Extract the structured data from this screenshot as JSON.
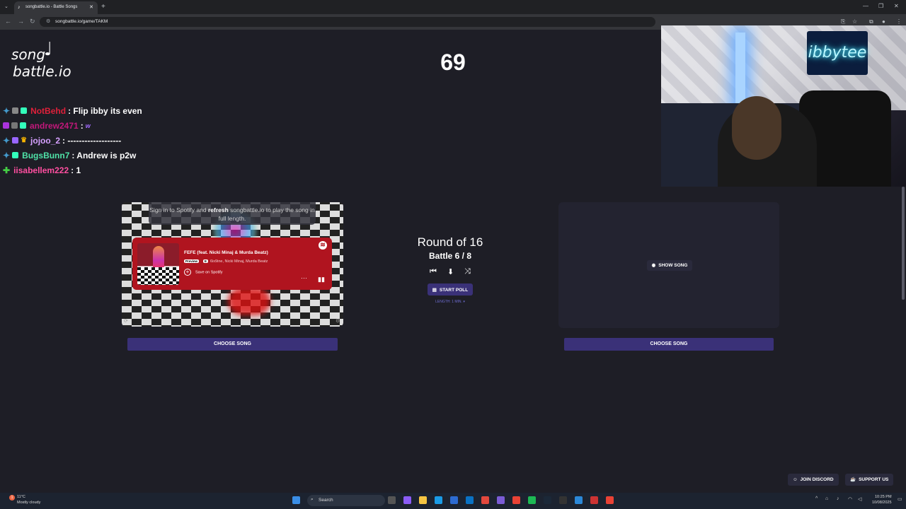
{
  "browser": {
    "tab_title": "songbattle.io - Battle Songs",
    "url": "songbattle.io/game/TAKM",
    "new_tab": "+"
  },
  "page": {
    "logo_line1": "song",
    "logo_line2": "battle.io",
    "counter": "69"
  },
  "chat": [
    {
      "user": "NotBehd",
      "message": ": Flip ibby its even",
      "color": "#e0203a"
    },
    {
      "user": "andrew2471",
      "message": ":",
      "color": "#c2187a",
      "emote": "w"
    },
    {
      "user": "jojoo_2",
      "message": ": -------------------",
      "color": "#d6a0ff"
    },
    {
      "user": "BugsBunn7",
      "message": ": Andrew is p2w",
      "color": "#4fe3a8"
    },
    {
      "user": "iisabellem222",
      "message": ": 1",
      "color": "#ff4fa0"
    }
  ],
  "webcam": {
    "neon_sign": "ibbytee"
  },
  "left_song": {
    "signin_prefix": "Sign in to Spotify and ",
    "signin_bold": "refresh",
    "signin_suffix": " songbattle.io to play the song in full length.",
    "title": "FEFE (feat. Nicki Minaj & Murda Beatz)",
    "preview_badge": "Preview",
    "explicit_badge": "E",
    "artists": "6ix9ine, Nicki Minaj, Murda Beatz",
    "save_label": "Save on Spotify",
    "choose_label": "CHOOSE SONG"
  },
  "center": {
    "round": "Round of 16",
    "battle": "Battle 6 / 8",
    "start_poll": "START POLL",
    "length": "LENGTH: 1 MIN."
  },
  "right_song": {
    "show_label": "SHOW SONG",
    "choose_label": "CHOOSE SONG"
  },
  "footer": {
    "discord": "JOIN DISCORD",
    "support": "SUPPORT US"
  },
  "taskbar": {
    "temperature": "11°C",
    "weather": "Mostly cloudy",
    "search": "Search",
    "time": "10:25 PM",
    "date": "10/08/2025"
  }
}
